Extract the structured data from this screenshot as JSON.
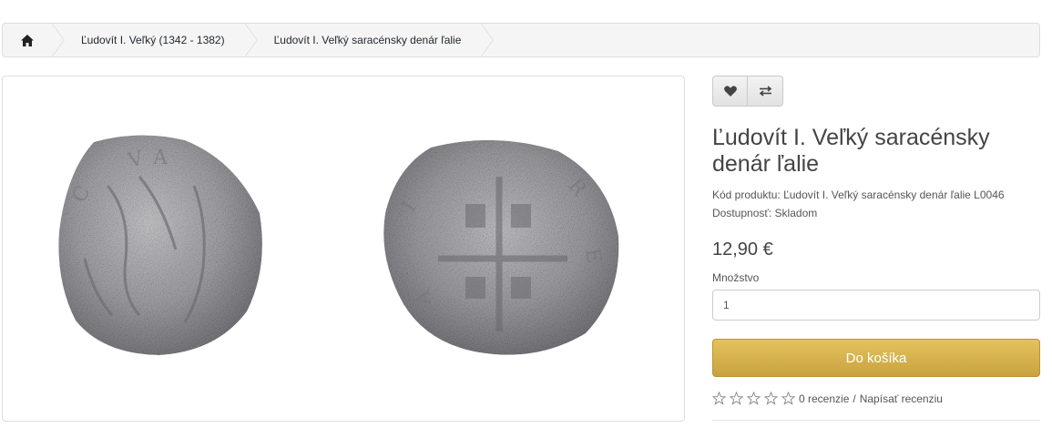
{
  "breadcrumb": {
    "home_icon": "home-icon",
    "items": [
      "Ľudovít I. Veľký (1342 - 1382)",
      "Ľudovít I. Veľký saracénsky denár ľalie"
    ]
  },
  "product": {
    "image_alt": "coin",
    "title": "Ľudovít I. Veľký saracénsky denár ľalie",
    "code_label": "Kód produktu:",
    "code_value": "Ľudovít I. Veľký saracénsky denár ľalie L0046",
    "availability_label": "Dostupnosť:",
    "availability_value": "Skladom",
    "price": "12,90 €",
    "quantity_label": "Množstvo",
    "quantity_value": "1",
    "add_to_cart": "Do košíka",
    "reviews_count": "0 recenzie",
    "write_review": "Napísať recenziu",
    "rating": 0,
    "rating_max": 5
  },
  "actions": {
    "wishlist_icon": "heart-icon",
    "compare_icon": "exchange-icon"
  },
  "colors": {
    "cart_button": "#d4b04a",
    "breadcrumb_bg": "#f5f5f5"
  }
}
